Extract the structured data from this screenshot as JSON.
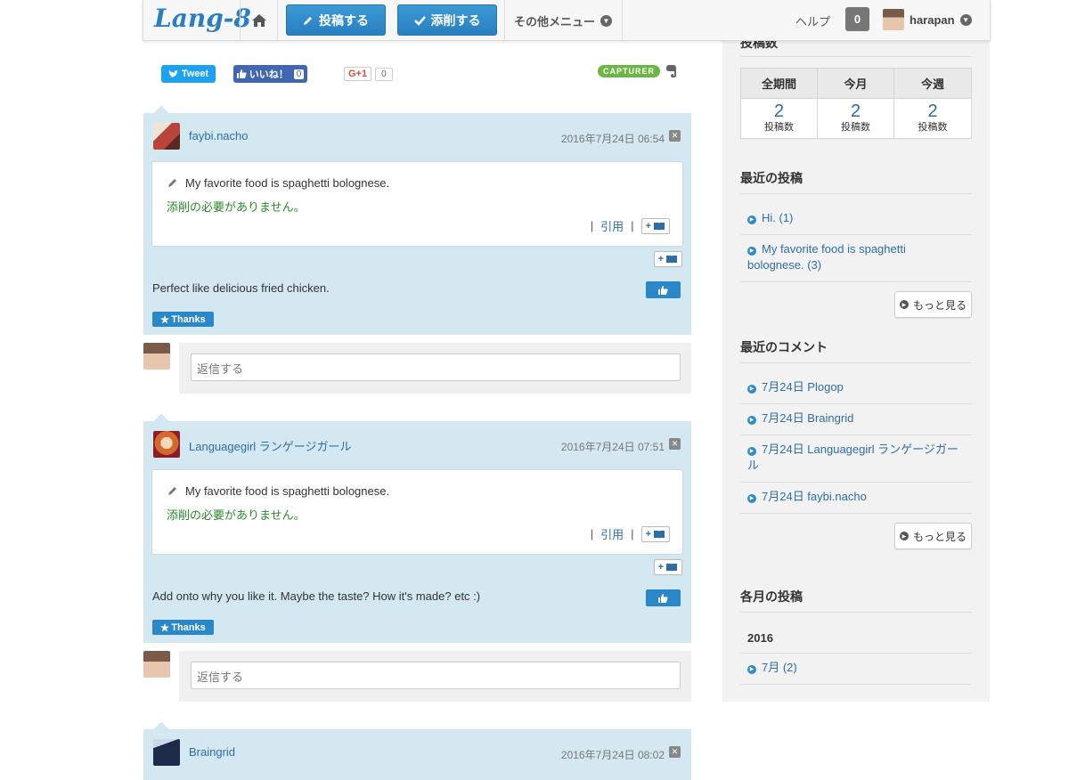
{
  "header": {
    "logo": "Lang-8",
    "post_button": "投稿する",
    "correct_button": "添削する",
    "other_menu": "その他メニュー",
    "help": "ヘルプ",
    "notification_count": "0",
    "username": "harapan"
  },
  "share": {
    "tweet": "Tweet",
    "facebook_like": "いいね！",
    "facebook_count": "0",
    "gplus": "G+1",
    "gplus_count": "0",
    "capturer": "CAPTURER"
  },
  "comments": [
    {
      "user": "faybi.nacho",
      "date": "2016年7月24日 06:54",
      "original": "My favorite food is spaghetti bolognese.",
      "no_correction": "添削の必要がありません。",
      "quote": "引用",
      "text": "Perfect like delicious fried chicken.",
      "thanks": "Thanks",
      "avatar_color": "#b8443a"
    },
    {
      "user": "Languagegirl ランゲージガール",
      "date": "2016年7月24日 07:51",
      "original": "My favorite food is spaghetti bolognese.",
      "no_correction": "添削の必要がありません。",
      "quote": "引用",
      "text": "Add onto why you like it. Maybe the taste? How it's made? etc :)",
      "thanks": "Thanks",
      "avatar_color": "#d4682e"
    },
    {
      "user": "Braingrid",
      "date": "2016年7月24日 08:02",
      "avatar_color": "#1d2a4a"
    }
  ],
  "reply": {
    "placeholder": "返信する"
  },
  "sidebar": {
    "post_count_title": "投稿数",
    "stats_headers": [
      "全期間",
      "今月",
      "今週"
    ],
    "stats_values": [
      "2",
      "2",
      "2"
    ],
    "stats_label": "投稿数",
    "recent_posts_title": "最近の投稿",
    "recent_posts": [
      "Hi. (1)",
      "My favorite food is spaghetti bolognese. (3)"
    ],
    "more": "もっと見る",
    "recent_comments_title": "最近のコメント",
    "recent_comments": [
      "7月24日 Plogop",
      "7月24日 Braingrid",
      "7月24日 Languagegirl ランゲージガール",
      "7月24日 faybi.nacho"
    ],
    "monthly_title": "各月の投稿",
    "year": "2016",
    "months": [
      "7月 (2)"
    ]
  },
  "colors": {
    "accent": "#2a87c8",
    "comment_bg": "#d3e8f0",
    "no_correction": "#2a8a2a"
  }
}
